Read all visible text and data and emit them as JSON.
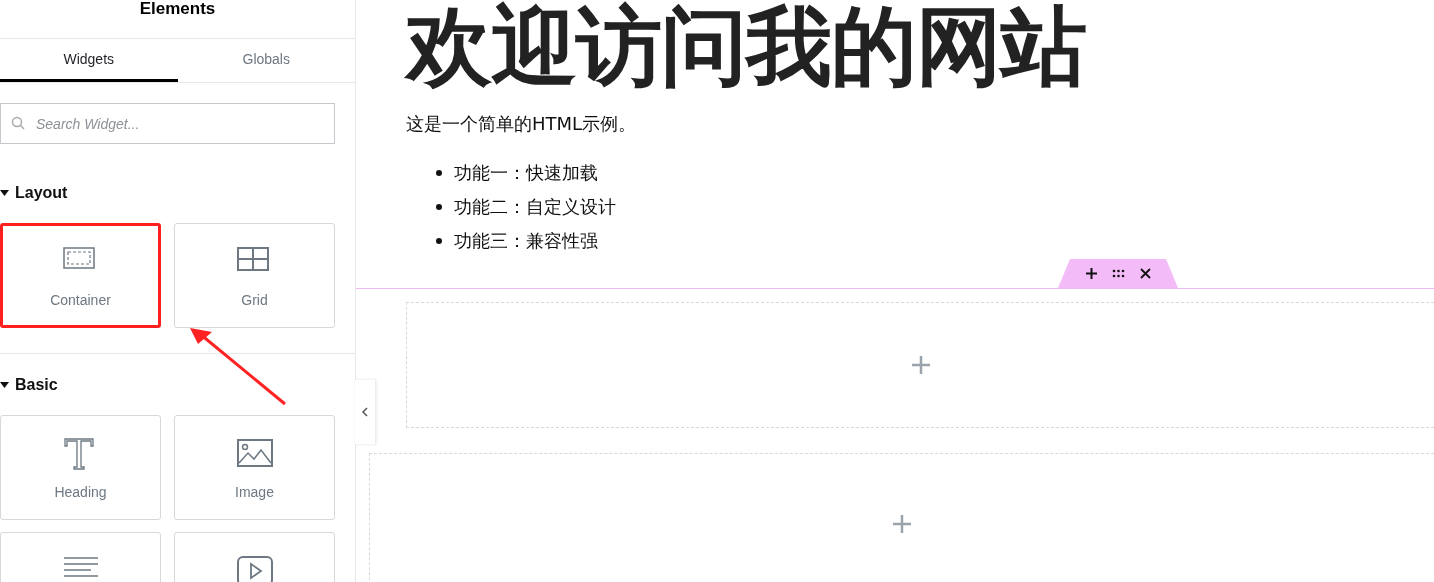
{
  "panel": {
    "title": "Elements",
    "tabs": [
      {
        "label": "Widgets",
        "selected": true
      },
      {
        "label": "Globals",
        "selected": false
      }
    ],
    "search": {
      "placeholder": "Search Widget..."
    },
    "categories": [
      {
        "name": "Layout",
        "expanded": true,
        "widgets": [
          {
            "label": "Container",
            "kind": "container",
            "highlighted": true
          },
          {
            "label": "Grid",
            "kind": "grid",
            "highlighted": false
          }
        ]
      },
      {
        "name": "Basic",
        "expanded": true,
        "widgets": [
          {
            "label": "Heading",
            "kind": "heading",
            "highlighted": false
          },
          {
            "label": "Image",
            "kind": "image",
            "highlighted": false
          },
          {
            "kind": "text",
            "highlighted": false
          },
          {
            "kind": "video",
            "highlighted": false
          }
        ]
      }
    ]
  },
  "canvas": {
    "heading": "欢迎访问我的网站",
    "paragraph": "这是一个简单的HTML示例。",
    "list": [
      "功能一：快速加载",
      "功能二：自定义设计",
      "功能三：兼容性强"
    ],
    "sections": [
      {
        "selected": true
      },
      {
        "selected": false
      }
    ]
  }
}
